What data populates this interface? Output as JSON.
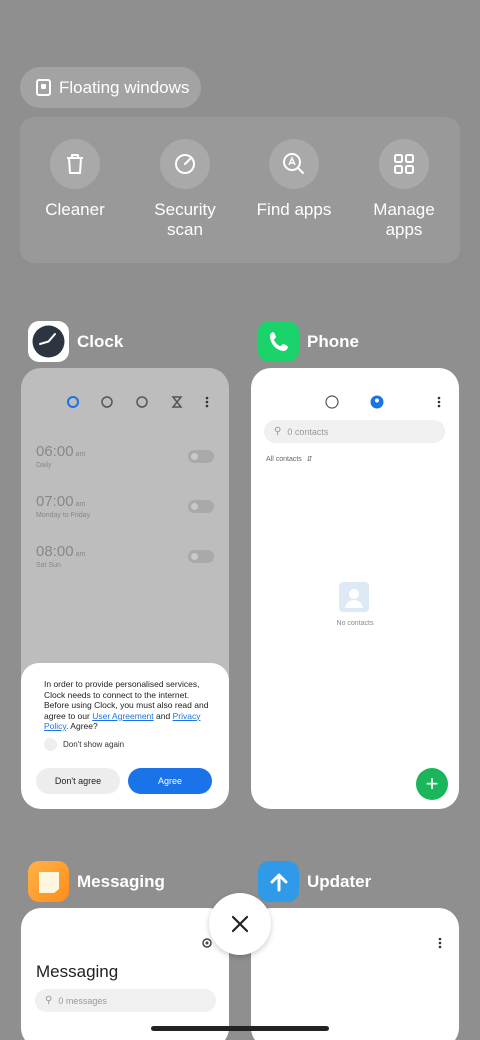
{
  "floating": {
    "label": "Floating windows",
    "icon": "floating-window-icon"
  },
  "tools": [
    {
      "label": "Cleaner",
      "icon": "trash-icon"
    },
    {
      "label": "Security scan",
      "icon": "security-scan-icon"
    },
    {
      "label": "Find apps",
      "icon": "find-apps-icon"
    },
    {
      "label": "Manage apps",
      "icon": "grid-icon"
    }
  ],
  "clock": {
    "name": "Clock",
    "alarms": [
      {
        "time": "06:00",
        "ampm": "am",
        "repeat": "Daily"
      },
      {
        "time": "07:00",
        "ampm": "am",
        "repeat": "Monday to Friday"
      },
      {
        "time": "08:00",
        "ampm": "am",
        "repeat": "Sat Sun"
      }
    ],
    "dialog": {
      "text1": "In order to provide personalised services, Clock needs to connect to the internet. Before using Clock, you must also read and agree to our",
      "link1": "User Agreement",
      "and": "and",
      "link2": "Privacy Policy",
      "text2": ". Agree?",
      "dont_show": "Don't show again",
      "disagree": "Don't agree",
      "agree": "Agree"
    }
  },
  "phone": {
    "name": "Phone",
    "search_placeholder": "0 contacts",
    "filter": "All contacts",
    "empty": "No contacts"
  },
  "messaging": {
    "name": "Messaging",
    "title": "Messaging",
    "search_placeholder": "0 messages"
  },
  "updater": {
    "name": "Updater"
  },
  "colors": {
    "accent": "#1a73e8",
    "phone_green": "#1bb55c",
    "background": "#8f8f8f"
  }
}
